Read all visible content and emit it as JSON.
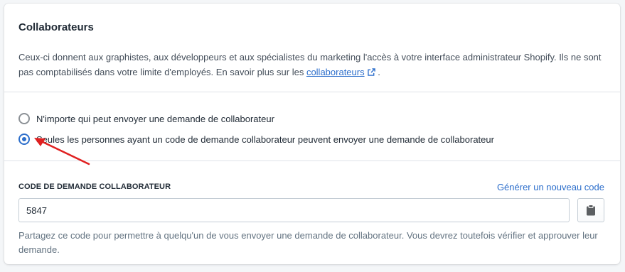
{
  "card": {
    "title": "Collaborateurs",
    "description_text": "Ceux-ci donnent aux graphistes, aux développeurs et aux spécialistes du marketing l'accès à votre interface administrateur Shopify. Ils ne sont pas comptabilisés dans votre limite d'employés. En savoir plus sur les ",
    "description_link": "collaborateurs",
    "description_end": " ."
  },
  "radios": {
    "options": [
      {
        "label": "N'importe qui peut envoyer une demande de collaborateur",
        "checked": false
      },
      {
        "label": "Seules les personnes ayant un code de demande collaborateur peuvent envoyer une demande de collaborateur",
        "checked": true
      }
    ]
  },
  "code": {
    "label": "CODE DE DEMANDE COLLABORATEUR",
    "generate_link": "Générer un nouveau code",
    "value": "5847",
    "copy_icon": "clipboard-icon",
    "help_text": "Partagez ce code pour permettre à quelqu'un de vous envoyer une demande de collaborateur. Vous devrez toutefois vérifier et approuver leur demande."
  },
  "colors": {
    "accent": "#2c6ecb",
    "annotation_arrow": "#e02020"
  }
}
